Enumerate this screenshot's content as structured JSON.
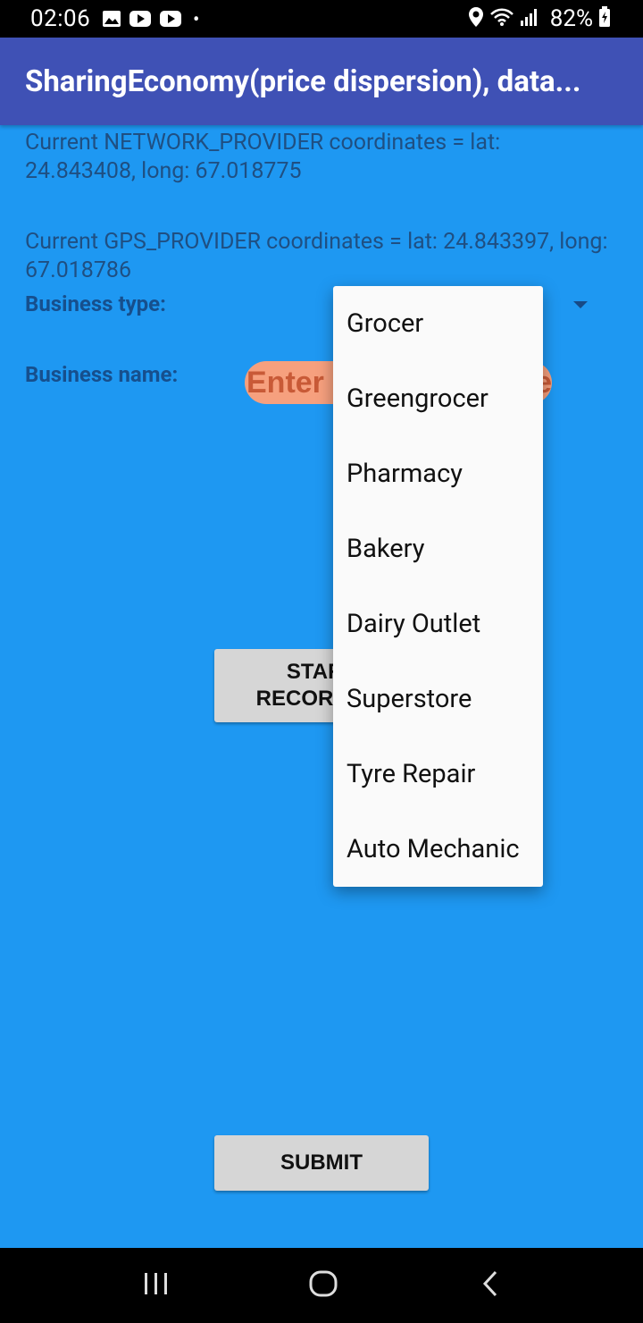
{
  "status_bar": {
    "time": "02:06",
    "dot": "•",
    "battery": "82%",
    "icons": [
      "gallery-icon",
      "youtube-icon",
      "youtube-icon",
      "location-icon",
      "wifi-icon",
      "signal-icon",
      "battery-icon"
    ]
  },
  "app_bar": {
    "title": "SharingEconomy(price dispersion), data..."
  },
  "location": {
    "network_text": "Current NETWORK_PROVIDER coordinates = lat: 24.843408, long: 67.018775",
    "gps_text": "Current GPS_PROVIDER coordinates = lat: 24.843397, long: 67.018786"
  },
  "form": {
    "business_type_label": "Business type:",
    "business_name_label": "Business name:",
    "business_name_placeholder": "Enter business name",
    "start_button_label": "START\nRECORDING",
    "submit_button_label": "SUBMIT"
  },
  "dropdown": {
    "options": [
      "Grocer",
      "Greengrocer",
      "Pharmacy",
      "Bakery",
      "Dairy Outlet",
      "Superstore",
      "Tyre Repair",
      "Auto Mechanic"
    ]
  },
  "colors": {
    "background": "#1E98F2",
    "app_bar": "#3F51B5",
    "input_fill": "#F6A07E",
    "button": "#D6D6D6"
  }
}
